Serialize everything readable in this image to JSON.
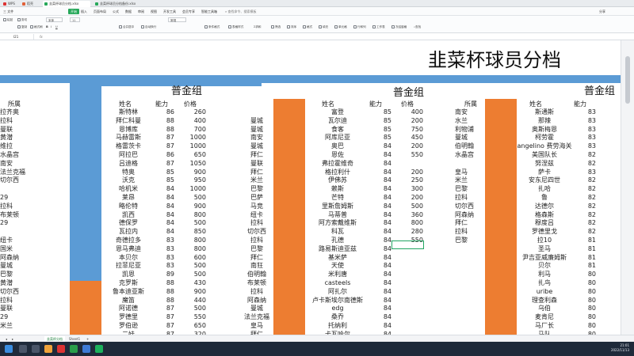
{
  "browser_tabs": [
    "WPS",
    "稻壳",
    "韭菜杯球员分档.xlsx",
    "韭菜杯球员分档备份.xlsx"
  ],
  "menu": {
    "file": "三 文件",
    "items": [
      "开始",
      "插入",
      "页面布局",
      "公式",
      "数据",
      "审阅",
      "视图",
      "开发工具",
      "会员专享",
      "智能工具箱"
    ],
    "active": "开始",
    "search": "查找命令、搜索模板",
    "share": "分享"
  },
  "ribbon": [
    "粘贴",
    "剪切",
    "复制",
    "格式刷",
    "宋体",
    "11",
    "合并居中",
    "自动换行",
    "常规",
    "条件格式",
    "表格样式",
    "求和",
    "筛选",
    "排序",
    "格式",
    "填充",
    "单元格",
    "行和列",
    "工作表",
    "冻结窗格",
    "查找"
  ],
  "formula_bar": {
    "cell": "I21",
    "fx": "fx"
  },
  "sheet_title": "韭菜杯球员分档",
  "groups": [
    {
      "title": "普金组",
      "headers": {
        "club": "所属",
        "name": "姓名",
        "ability": "能力",
        "price": "价格"
      },
      "col_a": [
        "拉齐奥",
        "拉科",
        "曼联",
        "黄潜",
        "维拉",
        "水晶宫",
        "南安",
        "法兰克福",
        "切尔西",
        "",
        "29",
        "拉科",
        "布莱顿",
        "29",
        "",
        "纽卡",
        "国米",
        "阿森纳",
        "曼城",
        "巴黎",
        "黄潜",
        "切尔西",
        "拉科",
        "曼联",
        "29",
        "米兰"
      ],
      "rows": [
        [
          "斯特林",
          "86",
          "260"
        ],
        [
          "拜仁科曼",
          "88",
          "400"
        ],
        [
          "恩博库",
          "88",
          "700"
        ],
        [
          "马赫雷斯",
          "87",
          "1000"
        ],
        [
          "格雷茨卡",
          "87",
          "1000"
        ],
        [
          "阿拉巴",
          "86",
          "650"
        ],
        [
          "吕迪格",
          "87",
          "1050"
        ],
        [
          "特奥",
          "85",
          "900"
        ],
        [
          "沃克",
          "85",
          "950"
        ],
        [
          "哈机米",
          "84",
          "1000"
        ],
        [
          "莱昂",
          "84",
          "500"
        ],
        [
          "略伦特",
          "84",
          "900"
        ],
        [
          "凯西",
          "84",
          "800"
        ],
        [
          "德保罗",
          "84",
          "500"
        ],
        [
          "瓦拉内",
          "84",
          "850"
        ],
        [
          "奇德拉多",
          "83",
          "800"
        ],
        [
          "恩马弗迪",
          "83",
          "800"
        ],
        [
          "本贝尔",
          "83",
          "600"
        ],
        [
          "拉菲尼亚",
          "83",
          "500"
        ],
        [
          "凯恩",
          "89",
          "500"
        ],
        [
          "克罗斯",
          "88",
          "430"
        ],
        [
          "鲁本迪亚斯",
          "88",
          "900"
        ],
        [
          "魔笛",
          "88",
          "440"
        ],
        [
          "阿诺德",
          "87",
          "500"
        ],
        [
          "罗德里",
          "87",
          "550"
        ],
        [
          "罗伯逊",
          "87",
          "650"
        ],
        [
          "二娃",
          "87",
          "320"
        ]
      ],
      "col_e": [
        "",
        "曼城",
        "曼城",
        "南安",
        "曼城",
        "拜仁",
        "曼联",
        "拜仁",
        "米兰",
        "巴黎",
        "巴萨",
        "马竞",
        "纽卡",
        "拉科",
        "切尔西",
        "拉科",
        "巴黎",
        "拜仁",
        "南狂",
        "伯明翰",
        "布莱顿",
        "拉科",
        "阿森纳",
        "曼城",
        "法兰克福",
        "皇马",
        "拜仁"
      ]
    },
    {
      "title": "普金组",
      "headers": {
        "name": "姓名",
        "ability": "能力",
        "price": "价格",
        "club": "所属"
      },
      "rows": [
        [
          "富登",
          "85",
          "400",
          "南安"
        ],
        [
          "瓦尔迪",
          "85",
          "200",
          "水兰"
        ],
        [
          "食客",
          "85",
          "750",
          "利物浦"
        ],
        [
          "阿库尼亚",
          "85",
          "450",
          "曼城"
        ],
        [
          "奥巴",
          "84",
          "200",
          "伯明翰"
        ],
        [
          "恩佐",
          "84",
          "550",
          "水晶宫"
        ],
        [
          "弗拉霍维奇",
          "84",
          "",
          ""
        ],
        [
          "格拉利什",
          "84",
          "200",
          "皇马"
        ],
        [
          "伊佛苏",
          "84",
          "250",
          "米兰"
        ],
        [
          "赖斯",
          "84",
          "300",
          "巴黎"
        ],
        [
          "芒特",
          "84",
          "200",
          "拉科"
        ],
        [
          "里斯詹姆斯",
          "84",
          "500",
          "切尔西"
        ],
        [
          "马蒂普",
          "84",
          "360",
          "阿森纳"
        ],
        [
          "阿方索戴维斯",
          "84",
          "800",
          "拜仁"
        ],
        [
          "科瓦",
          "84",
          "280",
          "拉科"
        ],
        [
          "孔德",
          "84",
          "550",
          "巴黎"
        ],
        [
          "路易斯迪亚兹",
          "84",
          "",
          ""
        ],
        [
          "基米萨",
          "84",
          "",
          ""
        ],
        [
          "天使",
          "84",
          "",
          ""
        ],
        [
          "米利唐",
          "84",
          "",
          ""
        ],
        [
          "casteels",
          "84",
          "",
          ""
        ],
        [
          "阿扎尔",
          "84",
          "",
          ""
        ],
        [
          "卢卡斯埃尔南德斯",
          "84",
          "",
          ""
        ],
        [
          "edg",
          "84",
          "",
          ""
        ],
        [
          "桑乔",
          "84",
          "",
          ""
        ],
        [
          "托纳利",
          "84",
          "",
          ""
        ],
        [
          "卡瓦哈尔",
          "84",
          "",
          ""
        ]
      ]
    },
    {
      "title": "普金组",
      "headers": {
        "name": "姓名",
        "ability": "能力"
      },
      "rows": [
        [
          "斯通斯",
          "83"
        ],
        [
          "那辣",
          "83"
        ],
        [
          "奥斯梅恩",
          "83"
        ],
        [
          "柯劳霍",
          "83"
        ],
        [
          "angelino 费劳海关",
          "83"
        ],
        [
          "美国队长",
          "82"
        ],
        [
          "努涅兹",
          "82"
        ],
        [
          "萨卡",
          "83"
        ],
        [
          "安东尼四世",
          "82"
        ],
        [
          "扎哈",
          "82"
        ],
        [
          "鲁",
          "82"
        ],
        [
          "达德尔",
          "82"
        ],
        [
          "格森斯",
          "82"
        ],
        [
          "穆度吕",
          "82"
        ],
        [
          "罗德里戈",
          "82"
        ],
        [
          "拉10",
          "81"
        ],
        [
          "圣马",
          "81"
        ],
        [
          "尹吉亚威廉姆斯",
          "81"
        ],
        [
          "贝尔",
          "81"
        ],
        [
          "利马",
          "80"
        ],
        [
          "扎鸟",
          "80"
        ],
        [
          "uribe",
          "80"
        ],
        [
          "理查利森",
          "80"
        ],
        [
          "乌伯",
          "80"
        ],
        [
          "麦肯尼",
          "80"
        ],
        [
          "马厂长",
          "80"
        ],
        [
          "马队",
          "80"
        ]
      ]
    }
  ],
  "sheet_tabs": [
    "韭菜杯分档",
    "Sheet1"
  ],
  "status": {
    "time": "21:01",
    "date": "2022/11/13"
  },
  "colors": {
    "accent_green": "#27a85a",
    "blue_band": "#5b9bd5",
    "orange_band": "#ed7d31",
    "taskbar": "#1f2a3a"
  }
}
